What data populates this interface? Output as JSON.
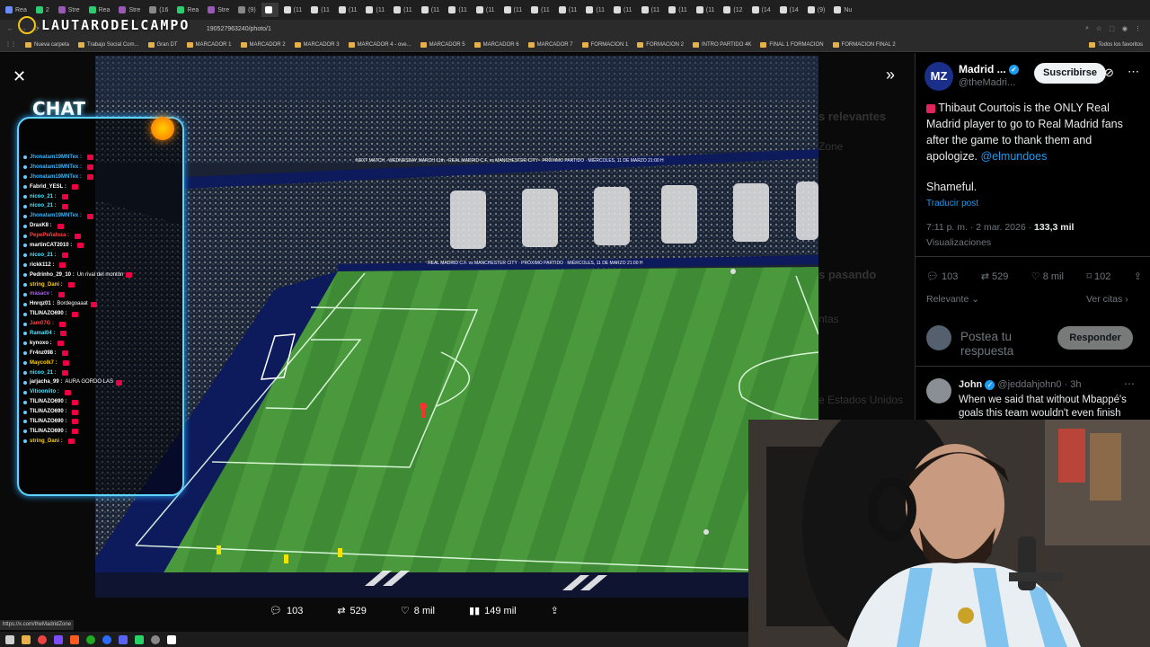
{
  "browser": {
    "tabs": [
      "Rea",
      "2",
      "Stre",
      "Rea",
      "Stre",
      "(16",
      "Rea",
      "Stre",
      "(9)",
      "",
      "(11",
      "(11",
      "(11",
      "(11",
      "(11",
      "(11",
      "(11",
      "(11",
      "(11",
      "(11",
      "(11",
      "(11",
      "(11",
      "(11",
      "(11",
      "(11",
      "(12",
      "(14",
      "(14",
      "(9)",
      "Nu"
    ],
    "url": "190527963240/photo/1",
    "bookmarks": [
      "Nueva carpeta",
      "Trabajo Social Com...",
      "Gran DT",
      "MARCADOR 1",
      "MARCADOR 2",
      "MARCADOR 3",
      "MARCADOR 4 - ove...",
      "MARCADOR 5",
      "MARCADOR 6",
      "MARCADOR 7",
      "FORMACION 1",
      "FORMACION 2",
      "INTRO PARTIDO 4K",
      "FINAL 1 FORMACION",
      "FORMACION FINAL 2"
    ],
    "all_bookmarks": "Todos los favoritos",
    "status_url": "https://x.com/theMadridZone"
  },
  "overlay": {
    "logo_text": "LAUTARODELCAMPO",
    "chat_title": "CHAT",
    "chat_lines": [
      {
        "user": "Jhonatam19MNTex :",
        "msg": "",
        "color": "#2fb5ff"
      },
      {
        "user": "Jhonatam19MNTex :",
        "msg": "",
        "color": "#2fb5ff"
      },
      {
        "user": "Jhonatam19MNTex :",
        "msg": "",
        "color": "#2fb5ff"
      },
      {
        "user": "Fabrid_YESL :",
        "msg": "",
        "color": "#ffffff"
      },
      {
        "user": "nicoo_21 :",
        "msg": "",
        "color": "#4fe3ff"
      },
      {
        "user": "nicoo_21 :",
        "msg": "",
        "color": "#4fe3ff"
      },
      {
        "user": "Jhonatam19MNTex :",
        "msg": "",
        "color": "#2fb5ff"
      },
      {
        "user": "DraxK8 :",
        "msg": "",
        "color": "#ffffff"
      },
      {
        "user": "PepePeñaloza :",
        "msg": "",
        "color": "#ff4444"
      },
      {
        "user": "martinCAT2010 :",
        "msg": "",
        "color": "#ffffff"
      },
      {
        "user": "nicoo_21 :",
        "msg": "",
        "color": "#4fe3ff"
      },
      {
        "user": "rickk112 :",
        "msg": "",
        "color": "#ffffff"
      },
      {
        "user": "Pedrinho_29_10 :",
        "msg": "Un rival del montón",
        "color": "#ffffff"
      },
      {
        "user": "string_Dani :",
        "msg": "",
        "color": "#ffcc00"
      },
      {
        "user": "masacv :",
        "msg": "",
        "color": "#b05cff"
      },
      {
        "user": "Hnrqz01 :",
        "msg": "Bordegoaaat",
        "color": "#ffffff"
      },
      {
        "user": "TILINAZO690 :",
        "msg": "",
        "color": "#ffffff"
      },
      {
        "user": "Jam07G :",
        "msg": "",
        "color": "#ff4444"
      },
      {
        "user": "Ramal04 :",
        "msg": "",
        "color": "#4fe3ff"
      },
      {
        "user": "kynoxo :",
        "msg": "",
        "color": "#ffffff"
      },
      {
        "user": "Fr4nz098 :",
        "msg": "",
        "color": "#ffffff"
      },
      {
        "user": "Maycolk7 :",
        "msg": "",
        "color": "#ffcc00"
      },
      {
        "user": "nicoo_21 :",
        "msg": "",
        "color": "#4fe3ff"
      },
      {
        "user": "jarjacha_99 :",
        "msg": "AURA GORDO LAS",
        "color": "#ffffff"
      },
      {
        "user": "Vitiooniito :",
        "msg": "",
        "color": "#4fe3ff"
      },
      {
        "user": "TILINAZO690 :",
        "msg": "",
        "color": "#ffffff"
      },
      {
        "user": "TILINAZO690 :",
        "msg": "",
        "color": "#ffffff"
      },
      {
        "user": "TILINAZO690 :",
        "msg": "",
        "color": "#ffffff"
      },
      {
        "user": "TILINAZO690 :",
        "msg": "",
        "color": "#ffffff"
      },
      {
        "user": "string_Dani :",
        "msg": "",
        "color": "#ffcc00"
      }
    ]
  },
  "viewer": {
    "replies": "103",
    "reposts": "529",
    "likes": "8 mil",
    "views": "149 mil",
    "ghost_texts": [
      "s relevantes",
      "Zone",
      "s pasando",
      "ntas",
      "e Estados Unidos"
    ],
    "stadium_banner_1": "NEXT MATCH · WEDNESDAY MARCH 11th · REAL MADRID C.F. vs MANCHESTER CITY · PRÓXIMO PARTIDO · MIÉRCOLES, 11 DE MARZO 21:00 H",
    "stadium_banner_2": "REAL MADRID C.F. vs MANCHESTER CITY · PRÓXIMO PARTIDO · MIÉRCOLES, 11 DE MARZO 21:00 H"
  },
  "tweet": {
    "avatar_text": "MZ",
    "author": "Madrid ...",
    "handle": "@theMadri...",
    "subscribe": "Suscribirse",
    "text": "Thibaut Courtois is the ONLY Real Madrid player to go to Real Madrid fans after the game to thank them and apologize.",
    "mention": "@elmundoes",
    "text2": "Shameful.",
    "translate": "Traducir post",
    "time": "7:11 p. m. · 2 mar. 2026 ·",
    "views_count": "133,3 mil",
    "views_label": "Visualizaciones",
    "replies": "103",
    "reposts": "529",
    "likes": "8 mil",
    "bookmarks": "102",
    "sort": "Relevante",
    "quotes": "Ver citas",
    "reply_placeholder": "Postea tu respuesta",
    "reply_button": "Responder",
    "reply_author": "John",
    "reply_handle": "@jeddahjohn0 · 3h",
    "reply_text": "When we said that without Mbappé's goals this team wouldn't even finish"
  },
  "colors": {
    "accent": "#1d9bf0",
    "chat_border": "#5fd4ff",
    "pitch": "#3f8f3a"
  }
}
